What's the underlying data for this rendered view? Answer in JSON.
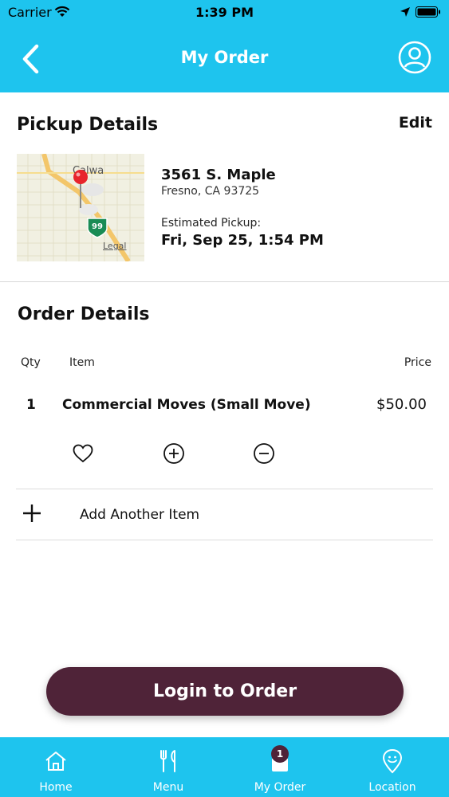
{
  "status_bar": {
    "carrier": "Carrier",
    "time": "1:39 PM"
  },
  "nav": {
    "title": "My Order"
  },
  "pickup": {
    "heading": "Pickup Details",
    "edit_label": "Edit",
    "map": {
      "place_label": "Calwa",
      "highway_label": "99",
      "legal_label": "Legal"
    },
    "street": "3561 S. Maple",
    "city": "Fresno, CA 93725",
    "estimated_label": "Estimated Pickup:",
    "estimated_time": "Fri, Sep 25, 1:54 PM"
  },
  "order": {
    "heading": "Order Details",
    "columns": {
      "qty": "Qty",
      "item": "Item",
      "price": "Price"
    },
    "items": [
      {
        "qty": "1",
        "name": "Commercial Moves (Small Move)",
        "price": "$50.00"
      }
    ],
    "add_item_label": "Add Another Item"
  },
  "login_button": "Login to Order",
  "tabs": [
    {
      "label": "Home",
      "icon": "home-icon"
    },
    {
      "label": "Menu",
      "icon": "menu-icon"
    },
    {
      "label": "My Order",
      "icon": "bag-icon",
      "badge": "1"
    },
    {
      "label": "Location",
      "icon": "location-icon"
    }
  ],
  "colors": {
    "accent": "#1ec4ee",
    "button": "#4f2338"
  }
}
